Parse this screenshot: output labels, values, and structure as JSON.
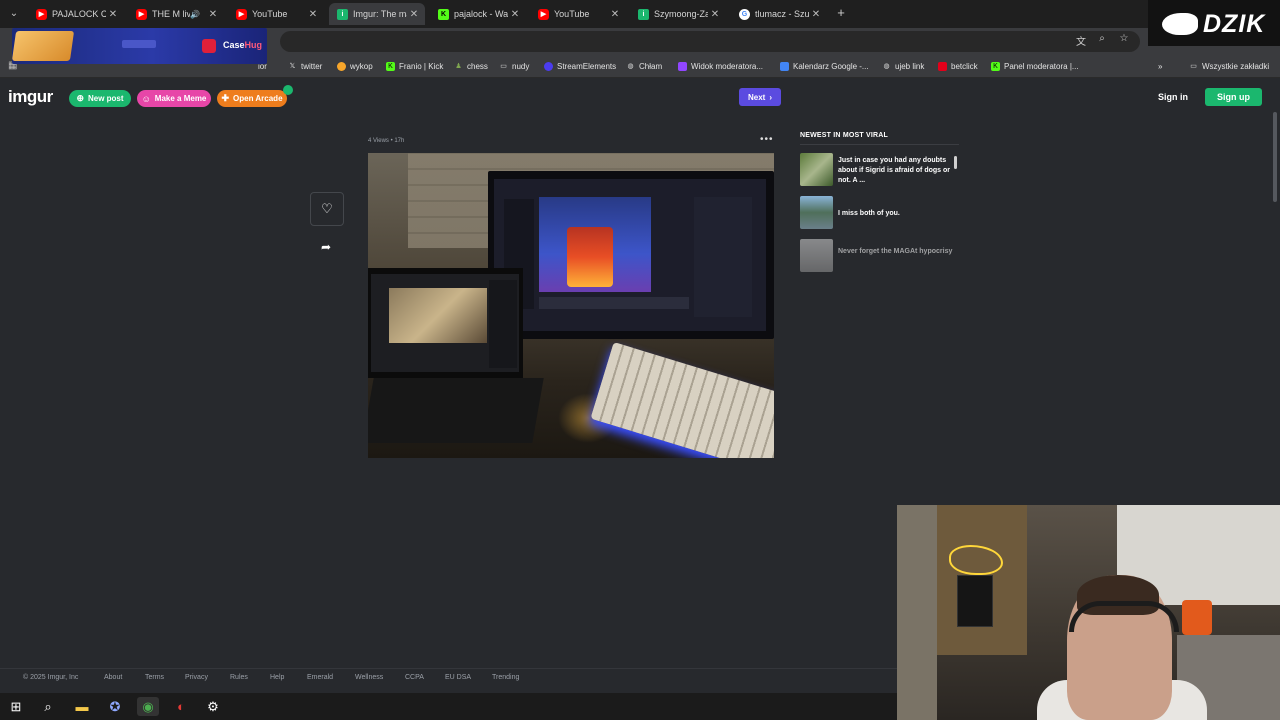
{
  "browser": {
    "tabs": [
      {
        "title": "PAJALOCK CZY",
        "favicon": "youtube-icon",
        "active": false,
        "audio": false
      },
      {
        "title": "THE M live",
        "favicon": "youtube-icon",
        "active": false,
        "audio": true
      },
      {
        "title": "YouTube",
        "favicon": "youtube-icon",
        "active": false,
        "audio": false
      },
      {
        "title": "Imgur: The ma",
        "favicon": "imgur-icon",
        "active": true,
        "audio": false
      },
      {
        "title": "pajalock - Wat",
        "favicon": "kick-icon",
        "active": false,
        "audio": false
      },
      {
        "title": "YouTube",
        "favicon": "youtube-icon",
        "active": false,
        "audio": false
      },
      {
        "title": "Szymoong-Zap",
        "favicon": "imgur-icon",
        "active": false,
        "audio": false
      },
      {
        "title": "tlumacz - Szuk",
        "favicon": "google-icon",
        "active": false,
        "audio": false
      }
    ],
    "bookmarks": [
      {
        "label": "ior",
        "icon": "folder-icon"
      },
      {
        "label": "twitter",
        "icon": "x-icon"
      },
      {
        "label": "wykop",
        "icon": "wykop-icon"
      },
      {
        "label": "Franio | Kick",
        "icon": "kick-icon"
      },
      {
        "label": "chess",
        "icon": "chess-icon"
      },
      {
        "label": "nudy",
        "icon": "folder-icon"
      },
      {
        "label": "StreamElements",
        "icon": "streamelements-icon"
      },
      {
        "label": "Chłam",
        "icon": "globe-icon"
      },
      {
        "label": "Widok moderatora...",
        "icon": "twitch-icon"
      },
      {
        "label": "Kalendarz Google -...",
        "icon": "calendar-icon"
      },
      {
        "label": "ujeb link",
        "icon": "link-icon"
      },
      {
        "label": "betclick",
        "icon": "betclick-icon"
      },
      {
        "label": "Panel moderatora |...",
        "icon": "kick-icon"
      }
    ],
    "all_bookmarks_label": "Wszystkie zakładki"
  },
  "overlays": {
    "casehug_text_a": "Case",
    "casehug_text_b": "Hug",
    "dzik_text": "DZIK"
  },
  "imgur": {
    "logo": "imgur",
    "new_post": "New post",
    "make_meme": "Make a Meme",
    "open_arcade": "Open Arcade",
    "next": "Next",
    "sign_in": "Sign in",
    "sign_up": "Sign up",
    "post_meta": "4 Views • 17h",
    "newest_title": "NEWEST IN MOST VIRAL",
    "viral": [
      {
        "title": "Just in case you had any doubts about if Sigrid is afraid of dogs or not.  A ..."
      },
      {
        "title": "I miss both of you."
      },
      {
        "title": "Never forget the MAGAt hypocrisy"
      }
    ],
    "footer": [
      "© 2025 Imgur, Inc",
      "About",
      "Terms",
      "Privacy",
      "Rules",
      "Help",
      "Emerald",
      "Wellness",
      "CCPA",
      "EU DSA",
      "Trending"
    ]
  },
  "colors": {
    "imgur_green": "#1bb76e",
    "meme_pink": "#e746a8",
    "arcade_orange": "#ee7d1d",
    "next_purple": "#5b4be0",
    "page_bg": "#27292d"
  }
}
